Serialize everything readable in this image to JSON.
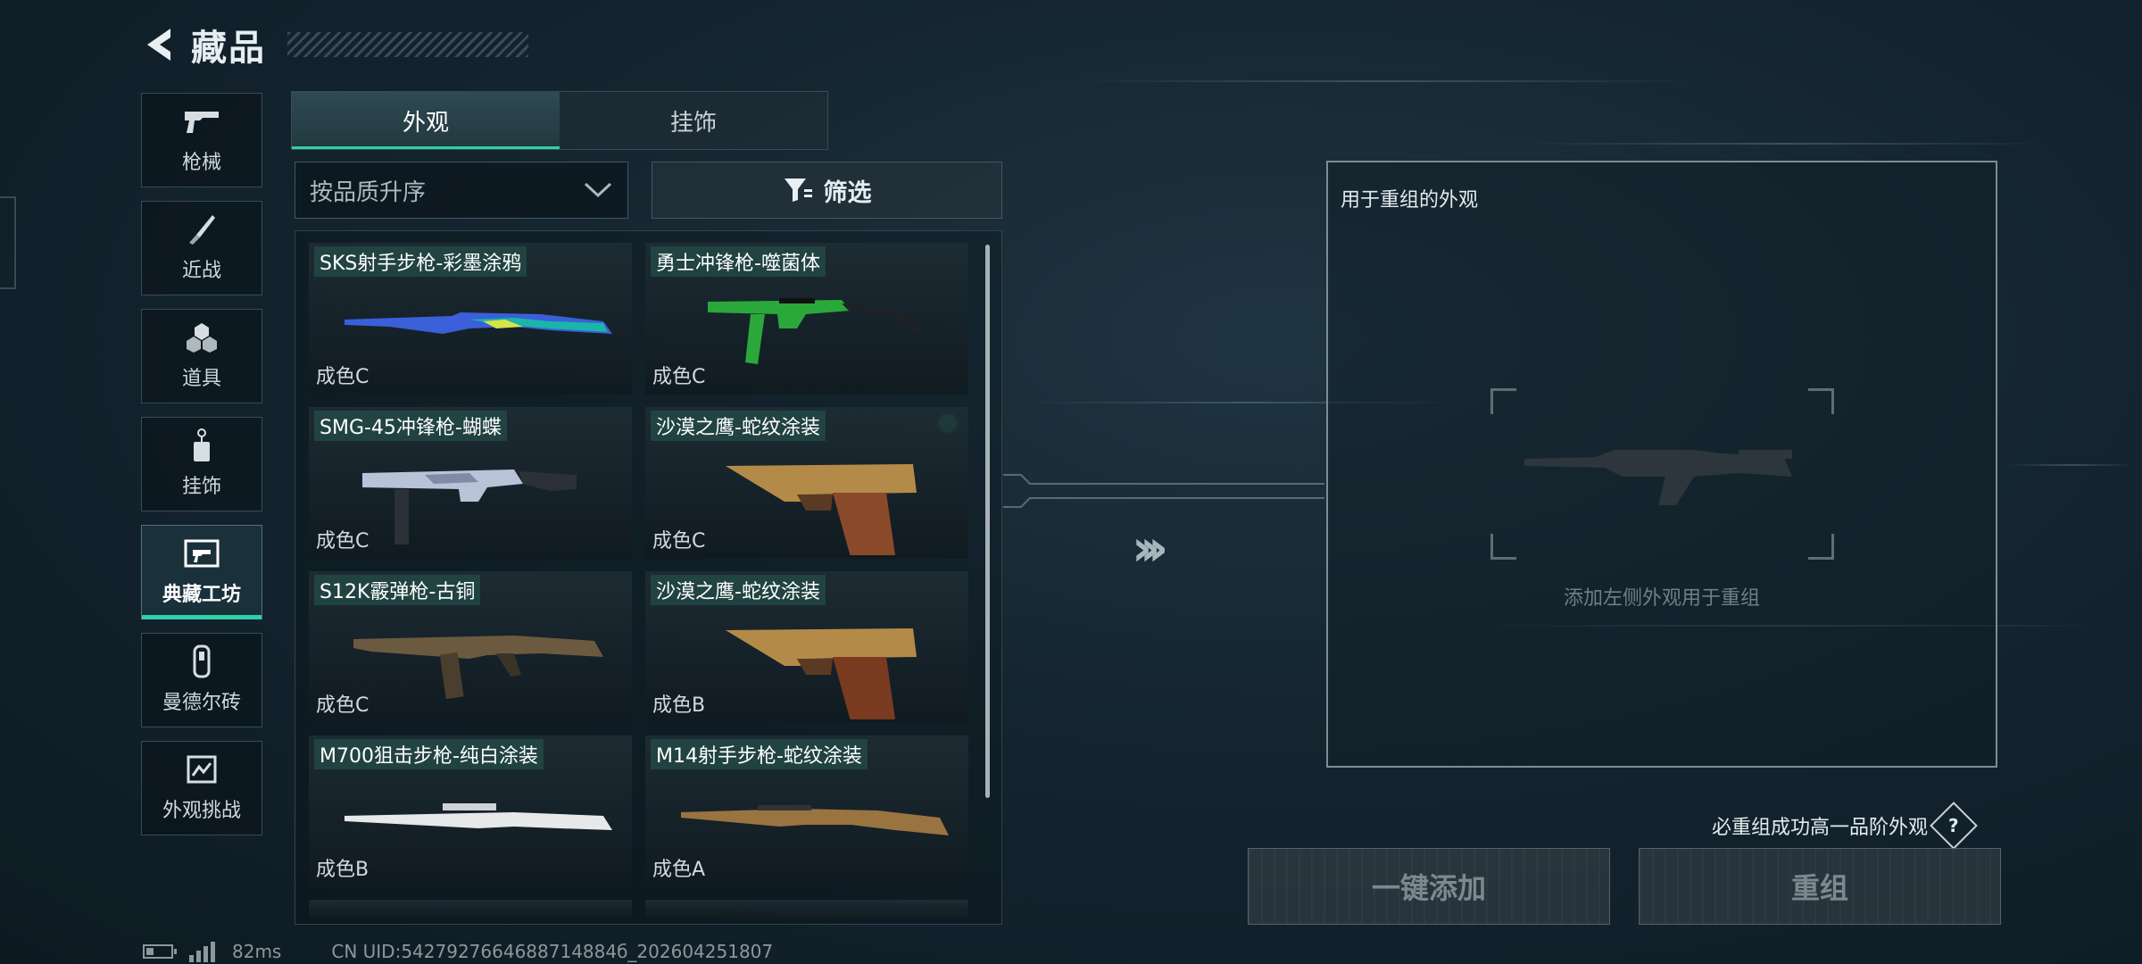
{
  "header": {
    "title": "藏品"
  },
  "nav": [
    {
      "label": "枪械",
      "icon": "gun-icon",
      "active": false
    },
    {
      "label": "近战",
      "icon": "knife-icon",
      "active": false
    },
    {
      "label": "道具",
      "icon": "gear-props-icon",
      "active": false
    },
    {
      "label": "挂饰",
      "icon": "charm-icon",
      "active": false
    },
    {
      "label": "典藏工坊",
      "icon": "workshop-icon",
      "active": true
    },
    {
      "label": "曼德尔砖",
      "icon": "brick-icon",
      "active": false
    },
    {
      "label": "外观挑战",
      "icon": "challenge-icon",
      "active": false
    }
  ],
  "tabs": [
    {
      "label": "外观",
      "active": true
    },
    {
      "label": "挂饰",
      "active": false
    }
  ],
  "sort": {
    "label": "按品质升序"
  },
  "filter": {
    "label": "筛选"
  },
  "items": [
    {
      "name": "SKS射手步枪-彩墨涂鸦",
      "grade": "成色C",
      "selected": false,
      "color": "#3a5fd9"
    },
    {
      "name": "勇士冲锋枪-噬菌体",
      "grade": "成色C",
      "selected": false,
      "color": "#2aa83a"
    },
    {
      "name": "SMG-45冲锋枪-蝴蝶",
      "grade": "成色C",
      "selected": false,
      "color": "#b9c3d8"
    },
    {
      "name": "沙漠之鹰-蛇纹涂装",
      "grade": "成色C",
      "selected": true,
      "color": "#a87a3a"
    },
    {
      "name": "S12K霰弹枪-古铜",
      "grade": "成色C",
      "selected": false,
      "color": "#6b5a40"
    },
    {
      "name": "沙漠之鹰-蛇纹涂装",
      "grade": "成色B",
      "selected": false,
      "color": "#a87a3a"
    },
    {
      "name": "M700狙击步枪-纯白涂装",
      "grade": "成色B",
      "selected": false,
      "color": "#e6e8ea"
    },
    {
      "name": "M14射手步枪-蛇纹涂装",
      "grade": "成色A",
      "selected": false,
      "color": "#9a7440"
    }
  ],
  "panel": {
    "title": "用于重组的外观",
    "hint": "添加左侧外观用于重组",
    "guarantee": "必重组成功高一品阶外观"
  },
  "buttons": {
    "add_all": "一键添加",
    "recombine": "重组"
  },
  "status": {
    "ping": "82ms",
    "uid": "CN UID:5427927664688714884б_202604251807"
  }
}
